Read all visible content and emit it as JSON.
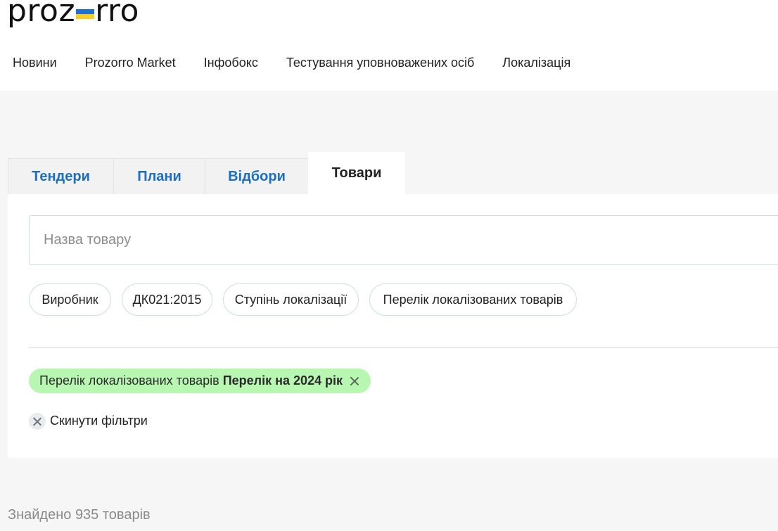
{
  "logo": {
    "left": "proz",
    "right": "rro"
  },
  "nav": [
    {
      "label": "Новини"
    },
    {
      "label": "Prozorro Market"
    },
    {
      "label": "Інфобокс"
    },
    {
      "label": "Тестування уповноважених осіб"
    },
    {
      "label": "Локалізація"
    }
  ],
  "tabs": [
    {
      "label": "Тендери",
      "active": false
    },
    {
      "label": "Плани",
      "active": false
    },
    {
      "label": "Відбори",
      "active": false
    },
    {
      "label": "Товари",
      "active": true
    }
  ],
  "search": {
    "placeholder": "Назва товару",
    "value": ""
  },
  "filters": [
    {
      "label": "Виробник"
    },
    {
      "label": "ДК021:2015"
    },
    {
      "label": "Ступінь локалізації"
    },
    {
      "label": "Перелік локалізованих товарів"
    }
  ],
  "active_filter": {
    "name": "Перелік локалізованих товарів",
    "value": "Перелік на 2024 рік",
    "color": "#b8f7b2"
  },
  "reset_label": "Скинути фільтри",
  "results_text": "Знайдено 935 товарів",
  "colors": {
    "tab_link": "#1b6ec2",
    "flag_blue": "#1f6fd6",
    "flag_yellow": "#f7cf22"
  }
}
